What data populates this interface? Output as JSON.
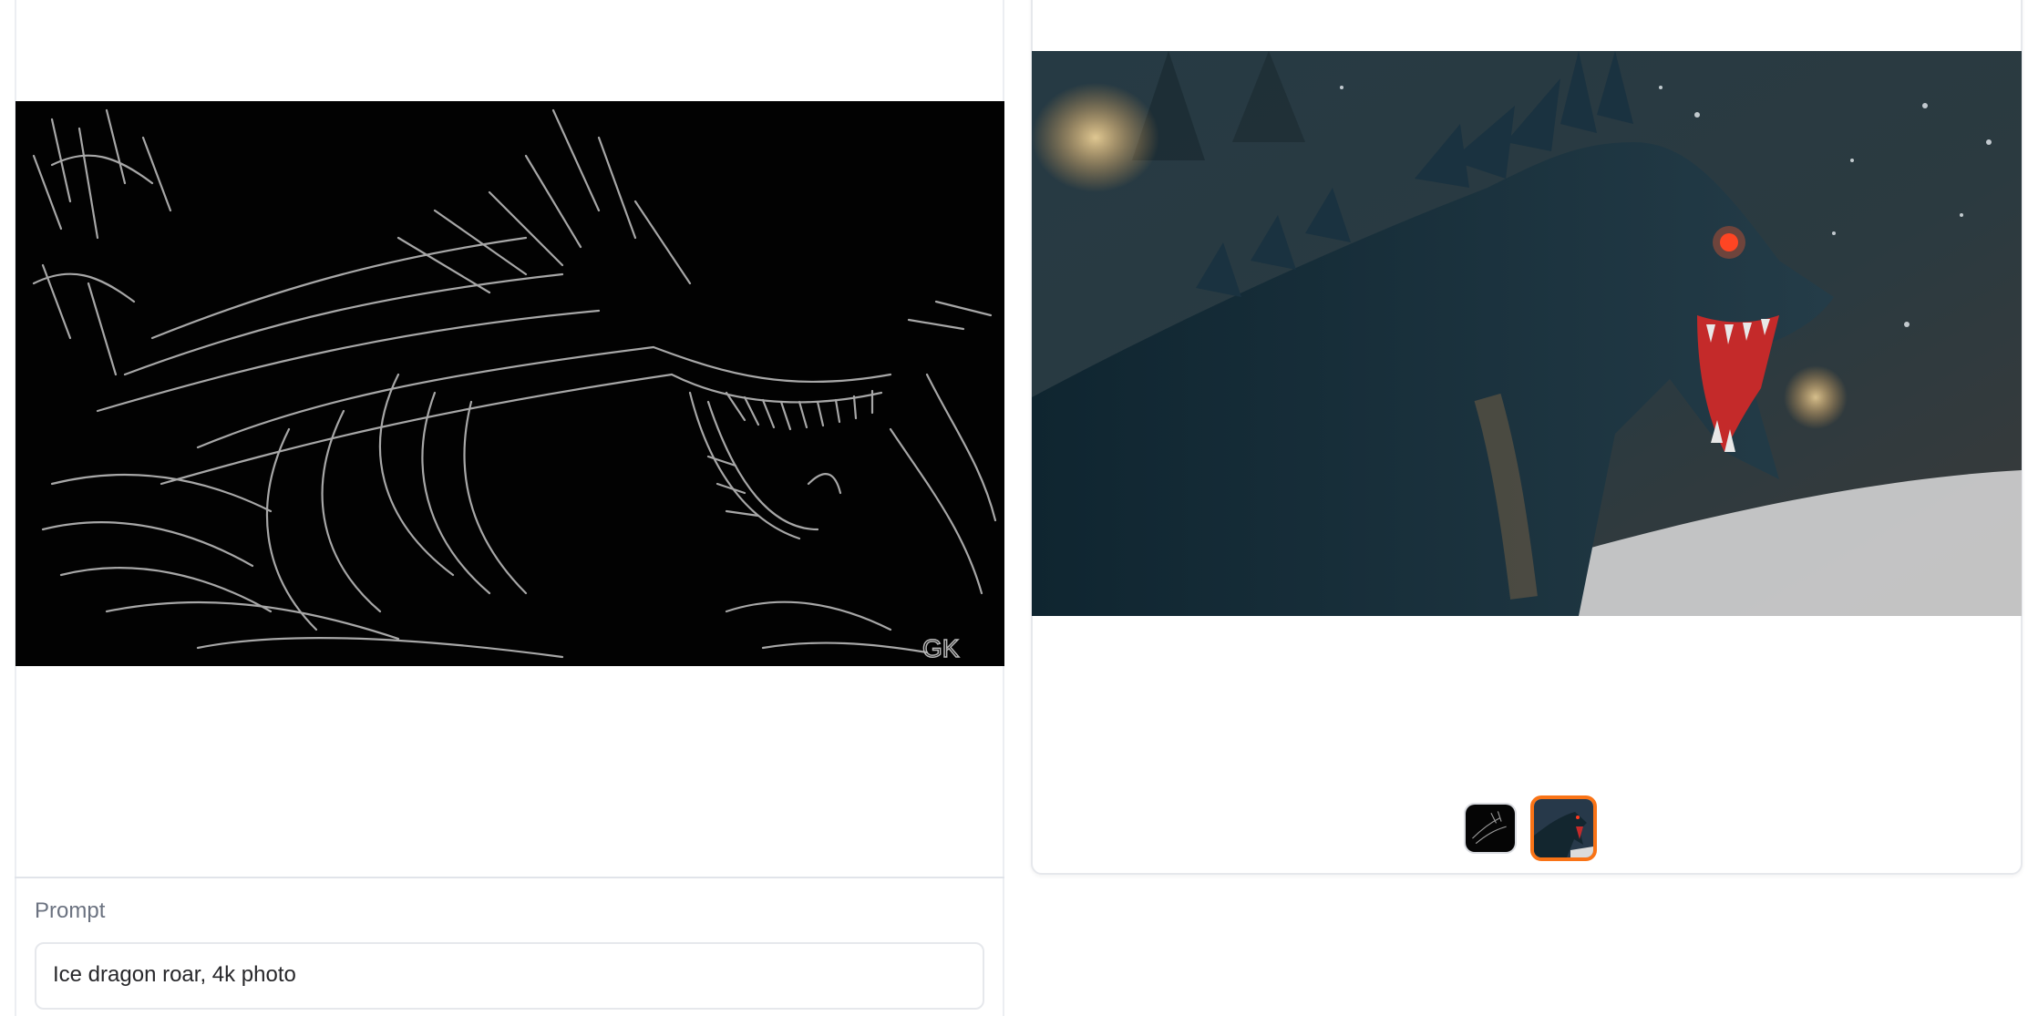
{
  "prompt": {
    "label": "Prompt",
    "value": "Ice dragon roar, 4k photo"
  },
  "input_image": {
    "description_icon": "canny-edge-dragon-image",
    "watermark": "GK"
  },
  "output_gallery": {
    "main_image_icon": "ice-dragon-photo",
    "thumbnails": [
      {
        "icon": "edge-map-thumbnail",
        "selected": false
      },
      {
        "icon": "dragon-photo-thumbnail",
        "selected": true
      }
    ],
    "accent_color": "#f97316"
  }
}
